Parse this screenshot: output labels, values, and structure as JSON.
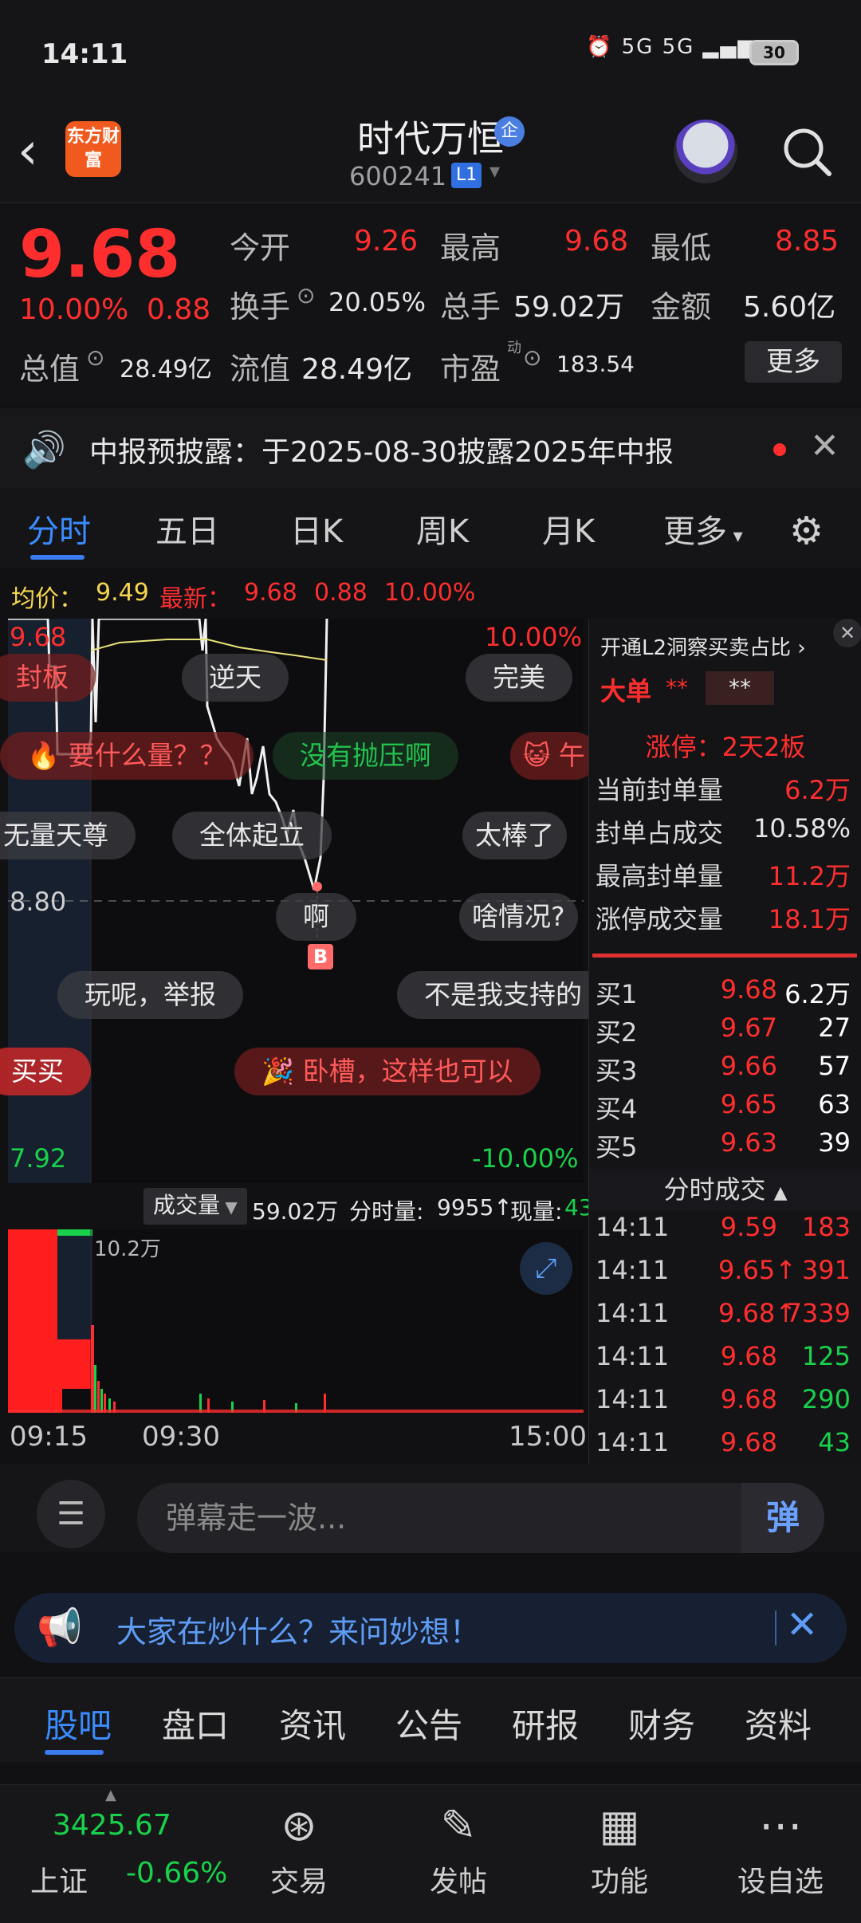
{
  "status_bar": {
    "time": "14:11",
    "network": "5G 5G",
    "battery": "30"
  },
  "header": {
    "logo_text": "东方财富",
    "stock_name": "时代万恒",
    "badge": "企",
    "code": "600241",
    "level": "L1"
  },
  "quote": {
    "price": "9.68",
    "change_pct": "10.00%",
    "change_amt": "0.88",
    "open_label": "今开",
    "open": "9.26",
    "high_label": "最高",
    "high": "9.68",
    "low_label": "最低",
    "low": "8.85",
    "turnover_label": "换手",
    "turnover": "20.05%",
    "volume_label": "总手",
    "volume": "59.02万",
    "amount_label": "金额",
    "amount": "5.60亿",
    "mktcap_label": "总值",
    "mktcap": "28.49亿",
    "float_label": "流值",
    "float_cap": "28.49亿",
    "pe_label": "市盈",
    "pe_sup": "动",
    "pe": "183.54",
    "more": "更多"
  },
  "notice": {
    "text": "中报预披露：于2025-08-30披露2025年中报"
  },
  "chart_tabs": [
    "分时",
    "五日",
    "日K",
    "周K",
    "月K",
    "更多"
  ],
  "info_row": {
    "avg_label": "均价：",
    "avg": "9.49",
    "latest_label": "最新：",
    "latest": "9.68",
    "chg": "0.88",
    "pct": "10.00%"
  },
  "price_chart": {
    "y_top": "9.68",
    "y_top_pct": "10.00%",
    "y_mid": "8.80",
    "y_bottom": "7.92",
    "y_bottom_pct": "-10.00%",
    "marker": "B",
    "danmu": [
      "封板",
      "逆天",
      "完美",
      "要什么量？？",
      "没有抛压啊",
      "午",
      "无量天尊",
      "全体起立",
      "太棒了",
      "啊",
      "啥情况?",
      "玩呢，举报",
      "不是我支持的",
      "买买",
      "卧槽，这样也可以"
    ]
  },
  "volume_chart": {
    "selector": "成交量",
    "total": "59.02万",
    "minute_label": "分时量:",
    "minute": "9955",
    "now_label": "现量:",
    "now": "43",
    "max_label": "10.2万"
  },
  "time_axis": [
    "09:15",
    "09:30",
    "15:00"
  ],
  "right_panel": {
    "l2_title": "开通L2洞察买卖占比",
    "big_order_label": "大单",
    "big_order_v1": "**",
    "big_order_v2": "**",
    "limit_title": "涨停：2天2板",
    "stats": [
      {
        "k": "当前封单量",
        "v": "6.2万"
      },
      {
        "k": "封单占成交",
        "v": "10.58%"
      },
      {
        "k": "最高封单量",
        "v": "11.2万"
      },
      {
        "k": "涨停成交量",
        "v": "18.1万"
      }
    ],
    "bids": [
      {
        "k": "买1",
        "p": "9.68",
        "v": "6.2万"
      },
      {
        "k": "买2",
        "p": "9.67",
        "v": "27"
      },
      {
        "k": "买3",
        "p": "9.66",
        "v": "57"
      },
      {
        "k": "买4",
        "p": "9.65",
        "v": "63"
      },
      {
        "k": "买5",
        "p": "9.63",
        "v": "39"
      }
    ],
    "ticks_title": "分时成交",
    "ticks": [
      {
        "t": "14:11",
        "p": "9.59",
        "v": "183",
        "dir": ""
      },
      {
        "t": "14:11",
        "p": "9.65↑",
        "v": "391",
        "dir": ""
      },
      {
        "t": "14:11",
        "p": "9.68↑",
        "v": "7339",
        "dir": ""
      },
      {
        "t": "14:11",
        "p": "9.68",
        "v": "125",
        "dir": ""
      },
      {
        "t": "14:11",
        "p": "9.68",
        "v": "290",
        "dir": ""
      },
      {
        "t": "14:11",
        "p": "9.68",
        "v": "43",
        "dir": ""
      }
    ]
  },
  "danmu_bar": {
    "placeholder": "弹幕走一波...",
    "send": "弹"
  },
  "ai_banner": {
    "text": "大家在炒什么？来问妙想！"
  },
  "bottom_tabs": [
    "股吧",
    "盘口",
    "资讯",
    "公告",
    "研报",
    "财务",
    "资料"
  ],
  "footer": {
    "index_value": "3425.67",
    "index_name": "上证",
    "index_chg": "-0.66%",
    "buttons": [
      "交易",
      "发帖",
      "功能",
      "设自选"
    ]
  },
  "colors": {
    "up": "#ff2e2e",
    "down": "#19d14b",
    "accent": "#3a7cf0",
    "avg_line": "#e8e27a"
  }
}
